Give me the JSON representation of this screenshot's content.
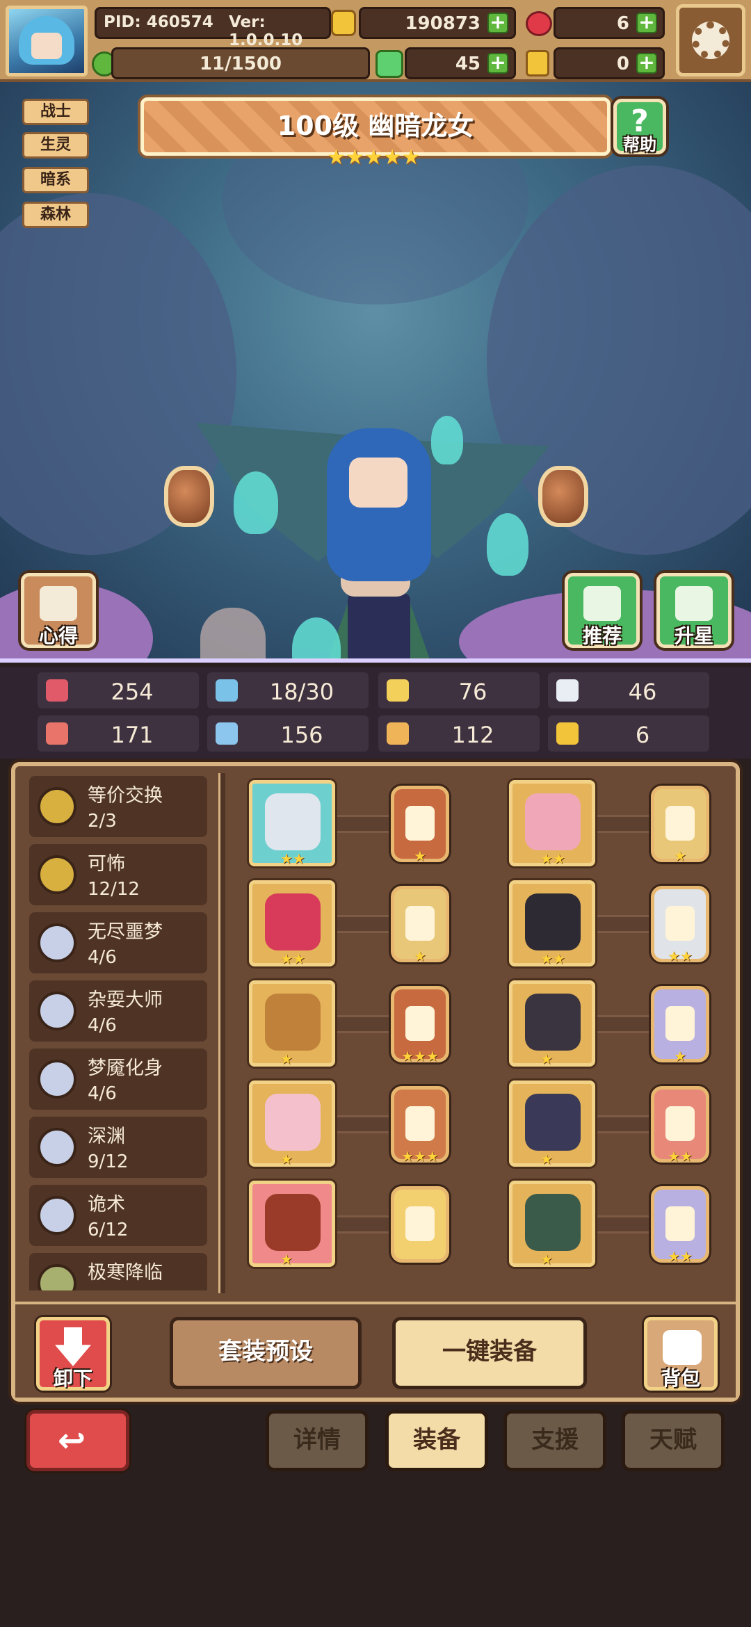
{
  "header": {
    "pid": "PID: 460574",
    "version": "Ver: 1.0.0.10",
    "gold": "190873",
    "red_gem": "6",
    "exp": "11/1500",
    "clover": "45",
    "key": "0"
  },
  "hero": {
    "title": "100级  幽暗龙女",
    "stars": 5,
    "tags": [
      "战士",
      "生灵",
      "暗系",
      "森林"
    ],
    "help_label": "帮助",
    "notes_label": "心得",
    "recommend_label": "推荐",
    "star_up_label": "升星"
  },
  "stats": [
    {
      "icon": "heart-icon",
      "value": "254",
      "color": "#e05a6a"
    },
    {
      "icon": "drop-icon",
      "value": "18/30",
      "color": "#7ac2e8"
    },
    {
      "icon": "shield-icon",
      "value": "76",
      "color": "#f2d05a"
    },
    {
      "icon": "wing-icon",
      "value": "46",
      "color": "#e8eef4"
    },
    {
      "icon": "fist-icon",
      "value": "171",
      "color": "#e8746a"
    },
    {
      "icon": "book-icon",
      "value": "156",
      "color": "#8cc6ee"
    },
    {
      "icon": "scroll-icon",
      "value": "112",
      "color": "#f0b458"
    },
    {
      "icon": "horseshoe-icon",
      "value": "6",
      "color": "#f2c43a"
    }
  ],
  "sets": [
    {
      "name": "等价交换",
      "count": "2/3",
      "coin": "#d8b040"
    },
    {
      "name": "可怖",
      "count": "12/12",
      "coin": "#d8b040"
    },
    {
      "name": "无尽噩梦",
      "count": "4/6",
      "coin": "#c8d0e8"
    },
    {
      "name": "杂耍大师",
      "count": "4/6",
      "coin": "#c8d0e8"
    },
    {
      "name": "梦魇化身",
      "count": "4/6",
      "coin": "#c8d0e8"
    },
    {
      "name": "深渊",
      "count": "9/12",
      "coin": "#c8d0e8"
    },
    {
      "name": "诡术",
      "count": "6/12",
      "coin": "#c8d0e8"
    },
    {
      "name": "极寒降临",
      "count": "",
      "coin": "#a8b070"
    }
  ],
  "equipment": [
    {
      "item": "sword-icon",
      "item_bg": "#6ecfcf",
      "item_color": "#dfe6ee",
      "item_stars": 2,
      "rune_color": "#c86a40",
      "rune_stars": 1
    },
    {
      "item": "fox-head-icon",
      "item_bg": "#e4b35a",
      "item_color": "#f0a8b8",
      "item_stars": 2,
      "rune_color": "#e8c878",
      "rune_stars": 1
    },
    {
      "item": "bear-icon",
      "item_bg": "#e4b35a",
      "item_color": "#d83a5a",
      "item_stars": 2,
      "rune_color": "#e8c878",
      "rune_stars": 1
    },
    {
      "item": "armor-icon",
      "item_bg": "#e4b35a",
      "item_color": "#2e2a34",
      "item_stars": 2,
      "rune_color": "#e0e4e8",
      "rune_stars": 2
    },
    {
      "item": "necklace-icon",
      "item_bg": "#e4b35a",
      "item_color": "#c0823a",
      "item_stars": 1,
      "rune_color": "#c86a40",
      "rune_stars": 3
    },
    {
      "item": "helmet-icon",
      "item_bg": "#e4b35a",
      "item_color": "#3a3440",
      "item_stars": 1,
      "rune_color": "#b8b0e0",
      "rune_stars": 1
    },
    {
      "item": "heart-wings-icon",
      "item_bg": "#e4b35a",
      "item_color": "#f4c0cc",
      "item_stars": 1,
      "rune_color": "#d07a4a",
      "rune_stars": 3
    },
    {
      "item": "ring-icon",
      "item_bg": "#e4b35a",
      "item_color": "#3a3a58",
      "item_stars": 1,
      "rune_color": "#e88878",
      "rune_stars": 2
    },
    {
      "item": "pot-icon",
      "item_bg": "#f08a8a",
      "item_color": "#9a3a28",
      "item_stars": 1,
      "rune_color": "#f2d070",
      "rune_stars": 0
    },
    {
      "item": "boots-icon",
      "item_bg": "#e4b35a",
      "item_color": "#3a5a4a",
      "item_stars": 1,
      "rune_color": "#b8b0e0",
      "rune_stars": 2
    }
  ],
  "actions": {
    "unequip": "卸下",
    "preset": "套装预设",
    "auto_equip": "一键装备",
    "backpack": "背包"
  },
  "tabs": [
    {
      "label": "详情",
      "active": false
    },
    {
      "label": "装备",
      "active": true
    },
    {
      "label": "支援",
      "active": false
    },
    {
      "label": "天赋",
      "active": false
    }
  ],
  "colors": {
    "accent_gold": "#f2d286",
    "panel_brown": "#6b4a35",
    "green_button": "#4ab860",
    "red_button": "#e04c4c"
  }
}
